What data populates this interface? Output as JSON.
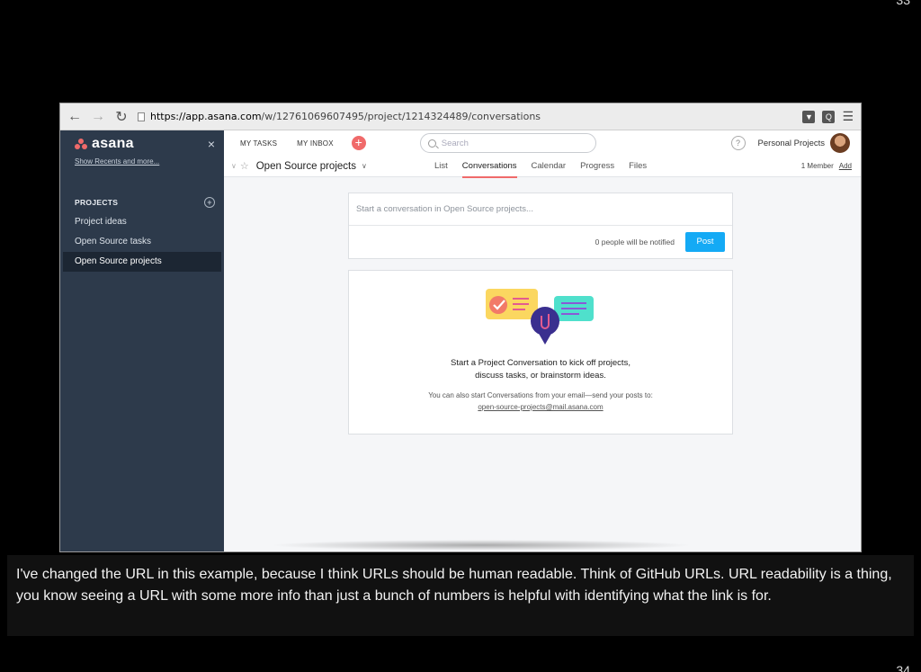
{
  "slide": {
    "page_top": "33",
    "page_bottom": "34"
  },
  "browser": {
    "url_host": "https://app.asana.com",
    "url_path": "/w/12761069607495/project/1214324489/conversations",
    "back_icon": "left-arrow",
    "forward_icon": "right-arrow",
    "reload_icon": "reload"
  },
  "sidebar": {
    "logo_text": "asana",
    "close_icon": "×",
    "show_recents": "Show Recents and more...",
    "section_title": "PROJECTS",
    "add_symbol": "+",
    "items": [
      {
        "label": "Project ideas",
        "active": false
      },
      {
        "label": "Open Source tasks",
        "active": false
      },
      {
        "label": "Open Source projects",
        "active": true
      }
    ]
  },
  "topbar": {
    "my_tasks": "MY TASKS",
    "my_inbox": "MY INBOX",
    "add_symbol": "+",
    "search_placeholder": "Search",
    "help_symbol": "?",
    "org_name": "Personal Projects"
  },
  "project": {
    "title": "Open Source projects",
    "tabs": [
      "List",
      "Conversations",
      "Calendar",
      "Progress",
      "Files"
    ],
    "active_tab": "Conversations",
    "members": "1 Member",
    "add_label": "Add"
  },
  "composer": {
    "placeholder": "Start a conversation in Open Source projects...",
    "notify_text": "0 people will be notified",
    "post_label": "Post"
  },
  "empty_state": {
    "title_line1": "Start a Project Conversation to kick off projects,",
    "title_line2": "discuss tasks, or brainstorm ideas.",
    "sub_text": "You can also start Conversations from your email—send your posts to:",
    "email": "open-source-projects@mail.asana.com"
  },
  "caption": "I've changed the URL in this example, because I think URLs should be human readable. Think of GitHub URLs. URL readability is a thing, you know seeing a URL with some more info than just a bunch of numbers is helpful with identifying what the link is for.",
  "colors": {
    "sidebar": "#2d3a4b",
    "accent": "#f06a6a",
    "post_button": "#14aaf5"
  }
}
